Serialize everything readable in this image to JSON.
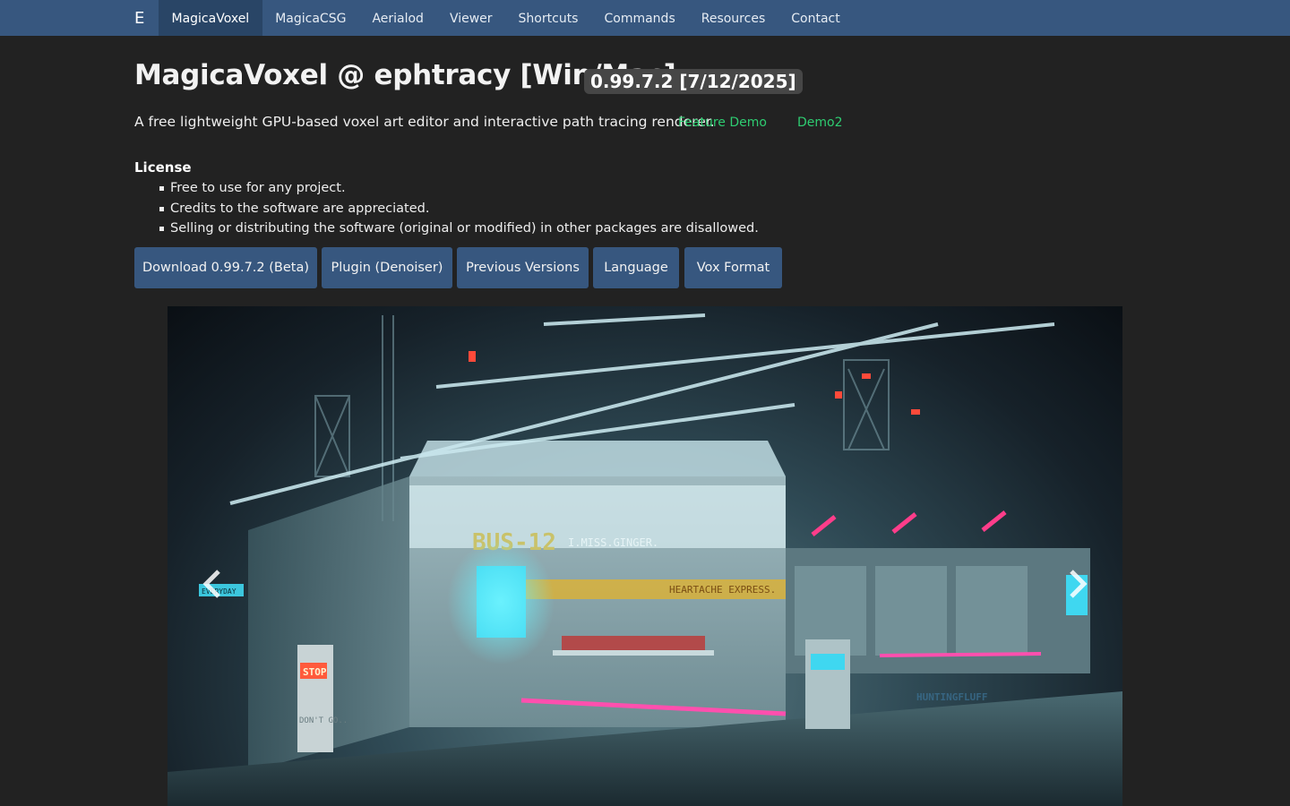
{
  "navbar": {
    "brand": "E",
    "items": [
      {
        "label": "MagicaVoxel",
        "active": true
      },
      {
        "label": "MagicaCSG"
      },
      {
        "label": "Aerialod"
      },
      {
        "label": "Viewer"
      },
      {
        "label": "Shortcuts"
      },
      {
        "label": "Commands"
      },
      {
        "label": "Resources"
      },
      {
        "label": "Contact"
      }
    ]
  },
  "header": {
    "title": "MagicaVoxel @ ephtracy [Win/Mac]",
    "version": "0.99.7.2 [7/12/2025]",
    "lead": "A free lightweight GPU-based voxel art editor and interactive path tracing renderer.",
    "links": [
      "Feature Demo",
      "Demo2"
    ]
  },
  "license": {
    "heading": "License",
    "items": [
      "Free to use for any project.",
      "Credits to the software are appreciated.",
      "Selling or distributing the software (original or modified) in other packages are disallowed."
    ]
  },
  "buttons": {
    "download": "Download 0.99.7.2 (Beta)",
    "plugin": "Plugin (Denoiser)",
    "previous": "Previous Versions",
    "language": "Language",
    "vox": "Vox Format"
  },
  "carousel": {
    "signs": {
      "bus": "BUS-12",
      "tag": "I.MISS.GINGER.",
      "banner": "HEARTACHE EXPRESS.",
      "stop": "STOP",
      "dont_go": "DON'T GO..",
      "credit": "HUNTINGFLUFF",
      "left_sign": "EVERYDAY"
    },
    "icons": [
      "chevron-left-icon",
      "chevron-right-icon"
    ]
  },
  "colors": {
    "navbar": "#37577f",
    "nav_active": "#294566",
    "background": "#222222",
    "link": "#2ecc71",
    "badge": "#464646"
  }
}
